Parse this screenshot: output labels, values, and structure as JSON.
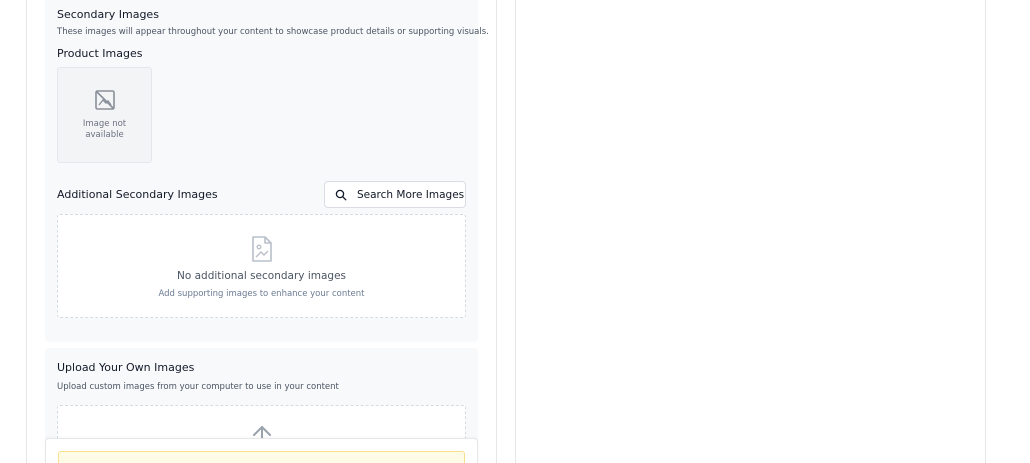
{
  "secondary": {
    "title": "Secondary Images",
    "subtitle": "These images will appear throughout your content to showcase product details or supporting visuals."
  },
  "product_images": {
    "title": "Product Images",
    "placeholder_icon": "image-off-icon",
    "placeholder_text": "Image not available"
  },
  "additional": {
    "title": "Additional Secondary Images",
    "search_button_label": "Search More Images",
    "search_icon": "search-icon",
    "empty_icon": "file-image-icon",
    "empty_title": "No additional secondary images",
    "empty_subtitle": "Add supporting images to enhance your content"
  },
  "upload": {
    "title": "Upload Your Own Images",
    "subtitle": "Upload custom images from your computer to use in your content",
    "upload_icon": "upload-arrow-icon"
  },
  "colors": {
    "panel_bg": "#f8f9fb",
    "notice_bg": "#fefbe6",
    "notice_border": "#f7e18a"
  }
}
